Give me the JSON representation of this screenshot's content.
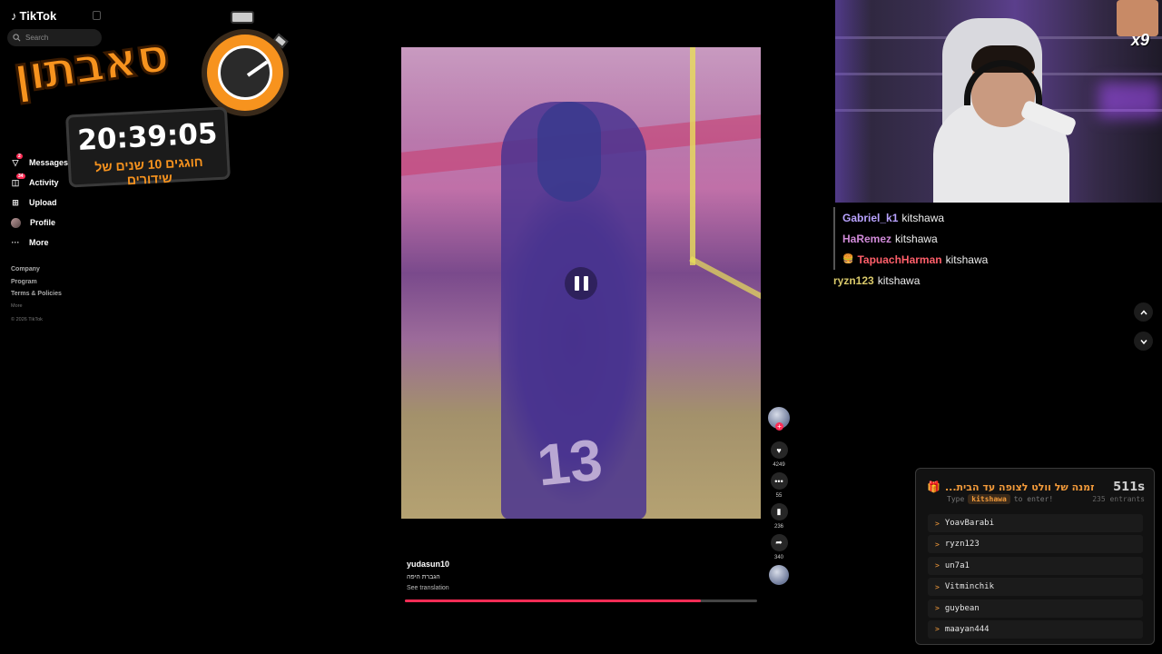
{
  "tiktok": {
    "logo": "TikTok",
    "search_placeholder": "Search",
    "nav": [
      {
        "label": "Messages",
        "icon": "paper-plane-icon",
        "badge": "2"
      },
      {
        "label": "Activity",
        "icon": "inbox-icon",
        "badge": "34"
      },
      {
        "label": "Upload",
        "icon": "plus-square-icon"
      },
      {
        "label": "Profile",
        "icon": "avatar"
      },
      {
        "label": "More",
        "icon": "ellipsis-icon"
      }
    ],
    "footer": [
      "Company",
      "Program",
      "Terms & Policies"
    ],
    "footer_more": "More",
    "copyright": "© 2026 TikTok"
  },
  "subathon": {
    "title": "סאבתון",
    "timer": "20:39:05",
    "caption": "חוגגים 10 שנים של שידורים"
  },
  "video": {
    "username": "yudasun10",
    "caption": "הגברת היפה",
    "see_translation": "See translation",
    "progress": 0.84,
    "likes": "4249",
    "comments": "55",
    "saves": "236",
    "shares": "340"
  },
  "webcam": {
    "overlay_badge": "x9"
  },
  "chat": [
    {
      "user": "Gabriel_k1",
      "message": "kitshawa",
      "color": "#b9a3ff",
      "bar": true
    },
    {
      "user": "HaRemez",
      "message": "kitshawa",
      "color": "#d08ad8",
      "bar": true
    },
    {
      "user": "TapuachHarman",
      "message": "kitshawa",
      "color": "#ff5f6a",
      "bar": true,
      "emoji": "🍔"
    },
    {
      "user": "ryzn123",
      "message": "kitshawa",
      "color": "#d8c86a",
      "bar": false
    }
  ],
  "giveaway": {
    "title": "זמנה של וולט לצופה עד הבית...",
    "time_left": "511s",
    "type_label": "Type",
    "keyword": "kitshawa",
    "enter_label": "to enter!",
    "entrants": "235 entrants",
    "entries": [
      "YoavBarabi",
      "ryzn123",
      "un7a1",
      "Vitminchik",
      "guybean",
      "maayan444"
    ]
  },
  "colors": {
    "accent": "#fe2c55",
    "giveaway_accent": "#f29a3a",
    "subathon_orange": "#f7931e"
  }
}
